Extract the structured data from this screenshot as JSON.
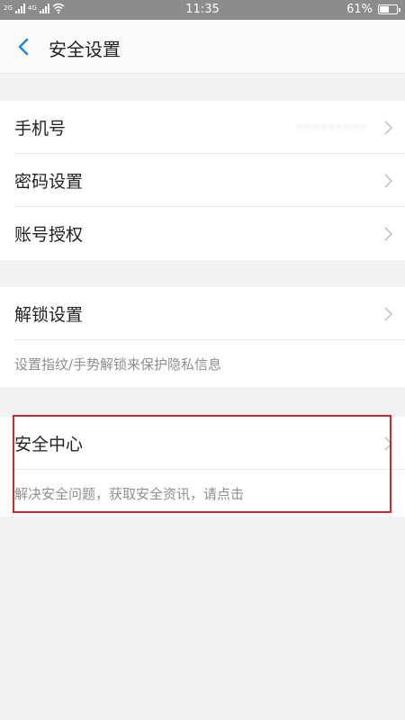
{
  "status_bar": {
    "network_tag_1": "2G",
    "network_tag_2": "4G",
    "time": "11:35",
    "battery_percent": "61%",
    "battery_level": 0.61
  },
  "header": {
    "title": "安全设置"
  },
  "group1": {
    "items": [
      {
        "label": "手机号",
        "value": "•••••••••"
      },
      {
        "label": "密码设置"
      },
      {
        "label": "账号授权"
      }
    ]
  },
  "group2": {
    "item_label": "解锁设置",
    "description": "设置指纹/手势解锁来保护隐私信息"
  },
  "group3": {
    "item_label": "安全中心",
    "description": "解决安全问题，获取安全资讯，请点击"
  },
  "colors": {
    "accent": "#1a8ae6",
    "highlight_border": "#d8232a"
  }
}
